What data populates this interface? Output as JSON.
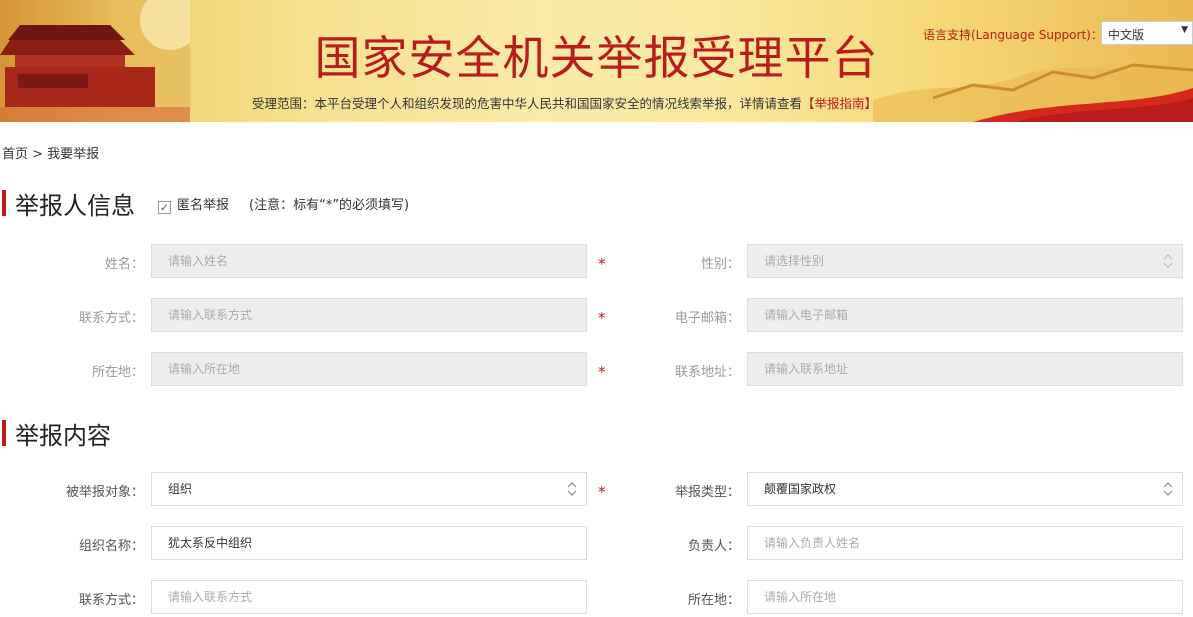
{
  "header": {
    "title": "国家安全机关举报受理平台",
    "scope_text": "受理范围：本平台受理个人和组织发现的危害中华人民共和国国家安全的情况线索举报，详情请查看",
    "guide_link": "【举报指南】",
    "language_label": "语言支持(Language Support)：",
    "language_value": "中文版"
  },
  "breadcrumb": "首页 > 我要举报",
  "reporter": {
    "section_title": "举报人信息",
    "anonymous_label": "匿名举报",
    "anonymous_checked": true,
    "note": "(注意：标有“*”的必须填写)",
    "fields": {
      "name": {
        "label": "姓名：",
        "placeholder": "请输入姓名"
      },
      "gender": {
        "label": "性别：",
        "placeholder": "请选择性别"
      },
      "contact": {
        "label": "联系方式：",
        "placeholder": "请输入联系方式"
      },
      "email": {
        "label": "电子邮箱：",
        "placeholder": "请输入电子邮箱"
      },
      "location": {
        "label": "所在地：",
        "placeholder": "请输入所在地"
      },
      "address": {
        "label": "联系地址：",
        "placeholder": "请输入联系地址"
      }
    }
  },
  "report": {
    "section_title": "举报内容",
    "fields": {
      "target": {
        "label": "被举报对象：",
        "value": "组织"
      },
      "type": {
        "label": "举报类型：",
        "value": "颠覆国家政权"
      },
      "org_name": {
        "label": "组织名称：",
        "value": "犹太系反中组织"
      },
      "leader": {
        "label": "负责人：",
        "placeholder": "请输入负责人姓名"
      },
      "contact": {
        "label": "联系方式：",
        "placeholder": "请输入联系方式"
      },
      "location": {
        "label": "所在地：",
        "placeholder": "请输入所在地"
      }
    }
  },
  "required_mark": "*",
  "colors": {
    "accent": "#c41a1a",
    "banner": "#f7e08e"
  }
}
